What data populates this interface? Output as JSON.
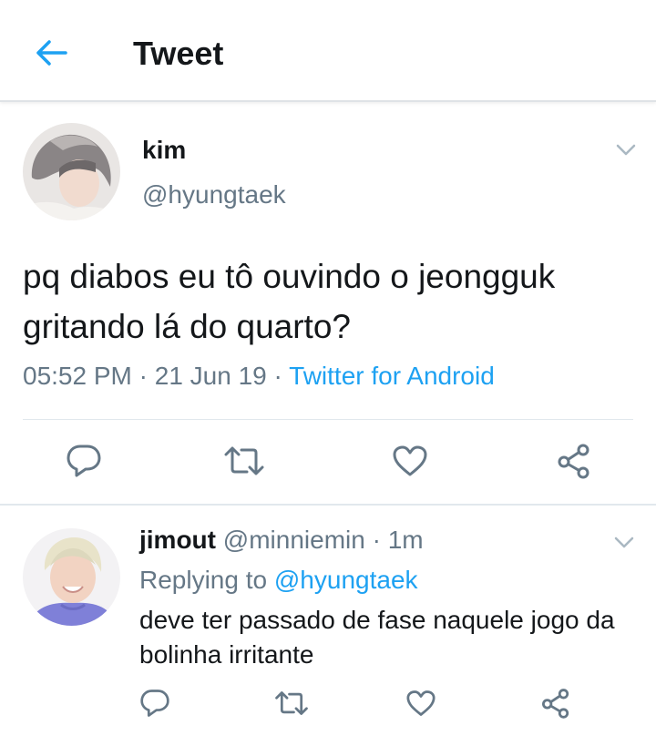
{
  "header": {
    "title": "Tweet",
    "back_icon": "arrow-left-icon"
  },
  "main_tweet": {
    "author_name": "kim",
    "author_handle": "@hyungtaek",
    "text": "pq diabos eu tô ouvindo o jeongguk gritando lá do quarto?",
    "time": "05:52 PM",
    "sep1": " · ",
    "date": "21 Jun 19",
    "sep2": " · ",
    "source": "Twitter for Android",
    "actions": [
      "reply-icon",
      "retweet-icon",
      "like-icon",
      "share-icon"
    ]
  },
  "reply": {
    "author_name": "jimout",
    "author_handle": "@minniemin",
    "sep": " · ",
    "time": "1m",
    "replying_prefix": "Replying to ",
    "replying_handle": "@hyungtaek",
    "text": "deve ter passado de fase naquele jogo da bolinha irritante",
    "actions": [
      "reply-icon",
      "retweet-icon",
      "like-icon",
      "share-icon"
    ]
  },
  "colors": {
    "accent": "#1da1f2",
    "text": "#14171a",
    "secondary": "#657786",
    "divider": "#e1e8ed"
  }
}
